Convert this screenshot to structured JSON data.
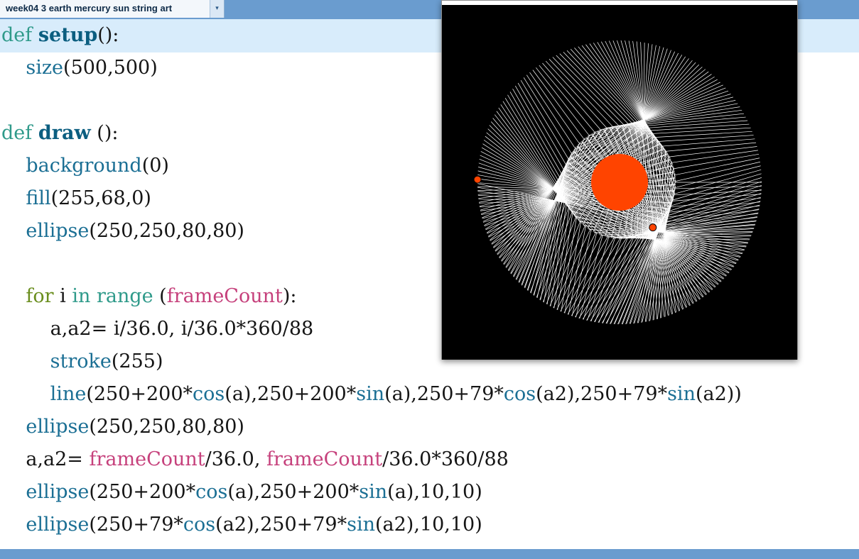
{
  "tab": {
    "title": "week04 3 earth  mercury  sun string art",
    "menu_arrow": "▾"
  },
  "code": {
    "lines": [
      [
        {
          "t": "def",
          "c": "kw"
        },
        {
          "t": " "
        },
        {
          "t": "setup",
          "c": "fn"
        },
        {
          "t": "():"
        }
      ],
      [
        {
          "t": "    "
        },
        {
          "t": "size",
          "c": "bi"
        },
        {
          "t": "(500,500)"
        }
      ],
      [],
      [
        {
          "t": "def",
          "c": "kw"
        },
        {
          "t": " "
        },
        {
          "t": "draw",
          "c": "fn"
        },
        {
          "t": " ():"
        }
      ],
      [
        {
          "t": "    "
        },
        {
          "t": "background",
          "c": "bi"
        },
        {
          "t": "(0)"
        }
      ],
      [
        {
          "t": "    "
        },
        {
          "t": "fill",
          "c": "bi"
        },
        {
          "t": "(255,68,0)"
        }
      ],
      [
        {
          "t": "    "
        },
        {
          "t": "ellipse",
          "c": "bi"
        },
        {
          "t": "(250,250,80,80)"
        }
      ],
      [],
      [
        {
          "t": "    "
        },
        {
          "t": "for",
          "c": "kwf"
        },
        {
          "t": " i "
        },
        {
          "t": "in",
          "c": "kw"
        },
        {
          "t": " "
        },
        {
          "t": "range",
          "c": "kw"
        },
        {
          "t": " ("
        },
        {
          "t": "frameCount",
          "c": "pv"
        },
        {
          "t": "):"
        }
      ],
      [
        {
          "t": "        a,a2= i/36.0, i/36.0*360/88"
        }
      ],
      [
        {
          "t": "        "
        },
        {
          "t": "stroke",
          "c": "bi"
        },
        {
          "t": "(255)"
        }
      ],
      [
        {
          "t": "        "
        },
        {
          "t": "line",
          "c": "bi"
        },
        {
          "t": "(250+200*"
        },
        {
          "t": "cos",
          "c": "bi"
        },
        {
          "t": "(a),250+200*"
        },
        {
          "t": "sin",
          "c": "bi"
        },
        {
          "t": "(a),250+79*"
        },
        {
          "t": "cos",
          "c": "bi"
        },
        {
          "t": "(a2),250+79*"
        },
        {
          "t": "sin",
          "c": "bi"
        },
        {
          "t": "(a2))"
        }
      ],
      [
        {
          "t": "    "
        },
        {
          "t": "ellipse",
          "c": "bi"
        },
        {
          "t": "(250,250,80,80)"
        }
      ],
      [
        {
          "t": "    a,a2= "
        },
        {
          "t": "frameCount",
          "c": "pv"
        },
        {
          "t": "/36.0, "
        },
        {
          "t": "frameCount",
          "c": "pv"
        },
        {
          "t": "/36.0*360/88"
        }
      ],
      [
        {
          "t": "    "
        },
        {
          "t": "ellipse",
          "c": "bi"
        },
        {
          "t": "(250+200*"
        },
        {
          "t": "cos",
          "c": "bi"
        },
        {
          "t": "(a),250+200*"
        },
        {
          "t": "sin",
          "c": "bi"
        },
        {
          "t": "(a),10,10)"
        }
      ],
      [
        {
          "t": "    "
        },
        {
          "t": "ellipse",
          "c": "bi"
        },
        {
          "t": "(250+79*"
        },
        {
          "t": "cos",
          "c": "bi"
        },
        {
          "t": "(a2),250+79*"
        },
        {
          "t": "sin",
          "c": "bi"
        },
        {
          "t": "(a2),10,10)"
        }
      ]
    ]
  },
  "sketch": {
    "background": "#000000",
    "stroke": "#ffffff",
    "fill": "#ff4400",
    "frame_count": 340
  },
  "colors": {
    "tab_bar": "#6a9ccf",
    "current_line": "#d8ecfb",
    "keyword": "#2f9a8a",
    "function_name": "#0b5e80",
    "builtin": "#1b6f94",
    "processing_var": "#c6417c"
  }
}
